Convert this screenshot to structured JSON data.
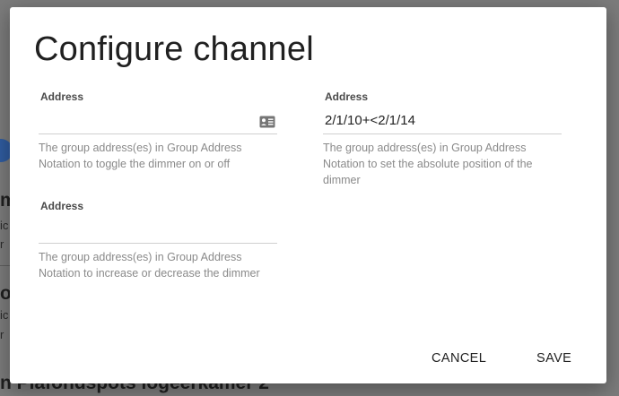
{
  "background": {
    "fragments": [
      "m",
      "ic",
      "r",
      "o",
      "ic",
      "r",
      "n"
    ],
    "bottom_text": "n Plafondspots logeerkamer 2"
  },
  "dialog": {
    "title": "Configure channel",
    "fields": [
      {
        "label": "Address",
        "value": "",
        "help": "The group address(es) in Group Address Notation to toggle the dimmer on or off"
      },
      {
        "label": "Address",
        "value": "2/1/10+<2/1/14",
        "help": "The group address(es) in Group Address Notation to set the absolute position of the dimmer"
      },
      {
        "label": "Address",
        "value": "",
        "help": "The group address(es) in Group Address Notation to increase or decrease the dimmer"
      }
    ],
    "icons": {
      "contact": "contact-card-icon"
    },
    "buttons": {
      "cancel": "CANCEL",
      "save": "SAVE"
    }
  },
  "colors": {
    "overlay": "#7b7b7b",
    "dialog_bg": "#ffffff",
    "label": "#4a4a4a",
    "help": "#8a8a8a",
    "underline": "#cfcfcf"
  }
}
